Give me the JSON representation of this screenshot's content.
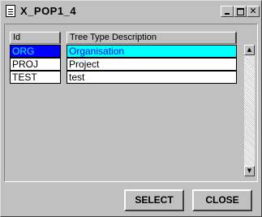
{
  "window": {
    "title": "X_POP1_4",
    "minimize_icon": "minimize-icon",
    "maximize_icon": "maximize-icon",
    "close_glyph": "✕"
  },
  "table": {
    "columns": [
      "Id",
      "Tree Type Description"
    ],
    "rows": [
      {
        "id": "ORG",
        "description": "Organisation",
        "selected": true
      },
      {
        "id": "PROJ",
        "description": "Project",
        "selected": false
      },
      {
        "id": "TEST",
        "description": "test",
        "selected": false
      }
    ],
    "selected_colors": {
      "id_bg": "#0000ff",
      "id_fg": "#00ffff",
      "desc_bg": "#00ffff",
      "desc_fg": "#0000ff"
    }
  },
  "scrollbar": {
    "up_glyph": "▲",
    "down_glyph": "▼"
  },
  "buttons": {
    "select_label": "SELECT",
    "close_label": "CLOSE"
  }
}
